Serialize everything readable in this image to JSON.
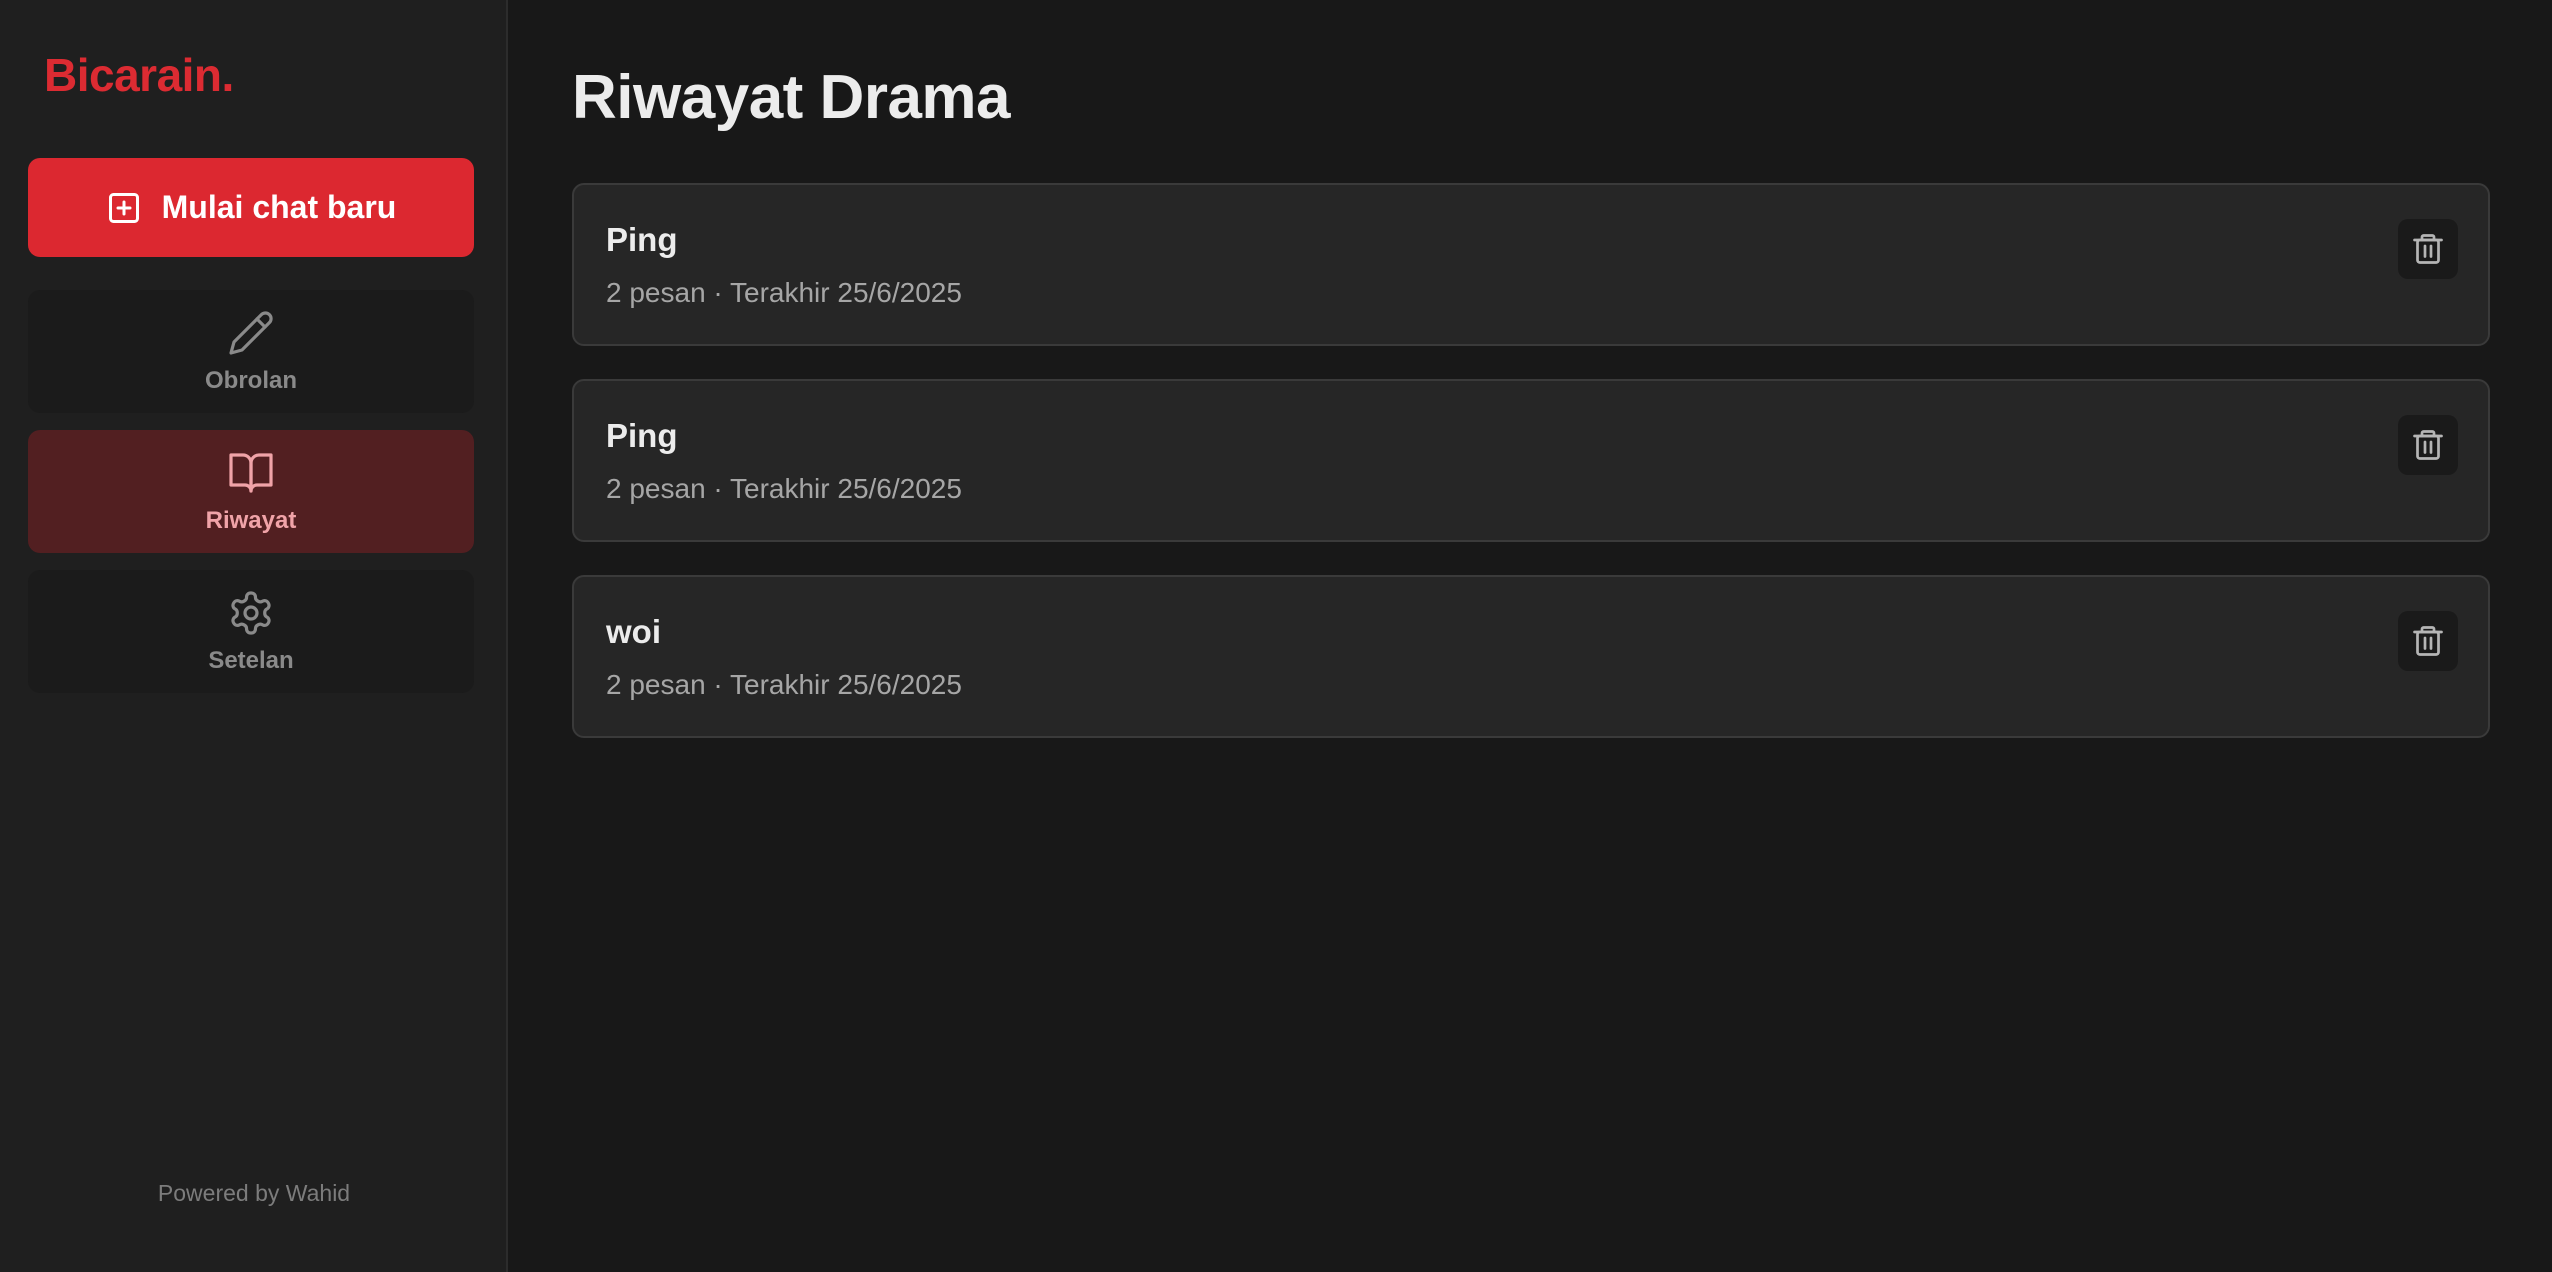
{
  "sidebar": {
    "brand": "Bicarain.",
    "new_chat": {
      "label": "Mulai chat baru",
      "icon": "plus-square-icon"
    },
    "nav": [
      {
        "label": "Obrolan",
        "icon": "pencil-icon",
        "active": false
      },
      {
        "label": "Riwayat",
        "icon": "open-book-icon",
        "active": true
      },
      {
        "label": "Setelan",
        "icon": "settings-icon",
        "active": false
      }
    ],
    "footer": "Powered by Wahid"
  },
  "main": {
    "title": "Riwayat Drama",
    "history": [
      {
        "title": "Ping",
        "meta": "2 pesan · Terakhir 25/6/2025"
      },
      {
        "title": "Ping",
        "meta": "2 pesan · Terakhir 25/6/2025"
      },
      {
        "title": "woi",
        "meta": "2 pesan · Terakhir 25/6/2025"
      }
    ],
    "delete_icon": "trash-icon"
  },
  "colors": {
    "accent": "#dc2830",
    "active_bg": "#521f21",
    "active_text": "#f0a3a8",
    "background": "#181818",
    "sidebar_bg": "#1f1f1f",
    "card_bg": "#262626"
  }
}
